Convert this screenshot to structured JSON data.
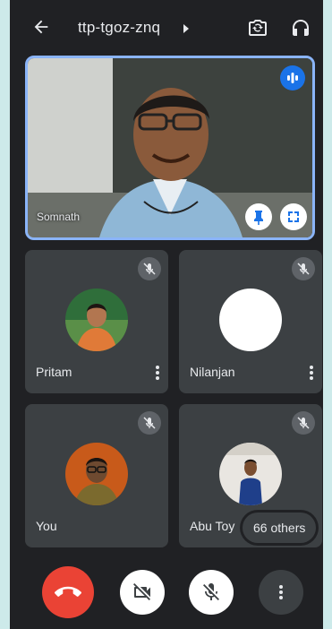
{
  "topbar": {
    "back_icon": "arrow-left-icon",
    "meeting_code": "ttp-tgoz-znq",
    "switch_camera_icon": "switch-camera-icon",
    "audio_output_icon": "headphones-icon"
  },
  "main_tile": {
    "participant_name": "Somnath",
    "speaking_icon": "audio-wave-icon",
    "pin_icon": "pin-icon",
    "fullscreen_icon": "fullscreen-icon"
  },
  "tiles": [
    {
      "name": "Pritam",
      "muted": true
    },
    {
      "name": "Nilanjan",
      "muted": true
    },
    {
      "name": "You",
      "muted": true
    },
    {
      "name": "Abu Toy",
      "muted": true
    }
  ],
  "others_label": "66 others",
  "controls": {
    "end_call_icon": "phone-hangup-icon",
    "camera_icon": "camera-off-icon",
    "mic_icon": "mic-off-icon",
    "more_icon": "more-vert-icon"
  },
  "colors": {
    "background": "#202124",
    "tile": "#3c4043",
    "active_border": "#8ab4f8",
    "end_call": "#ea4335",
    "accent": "#1a73e8"
  }
}
